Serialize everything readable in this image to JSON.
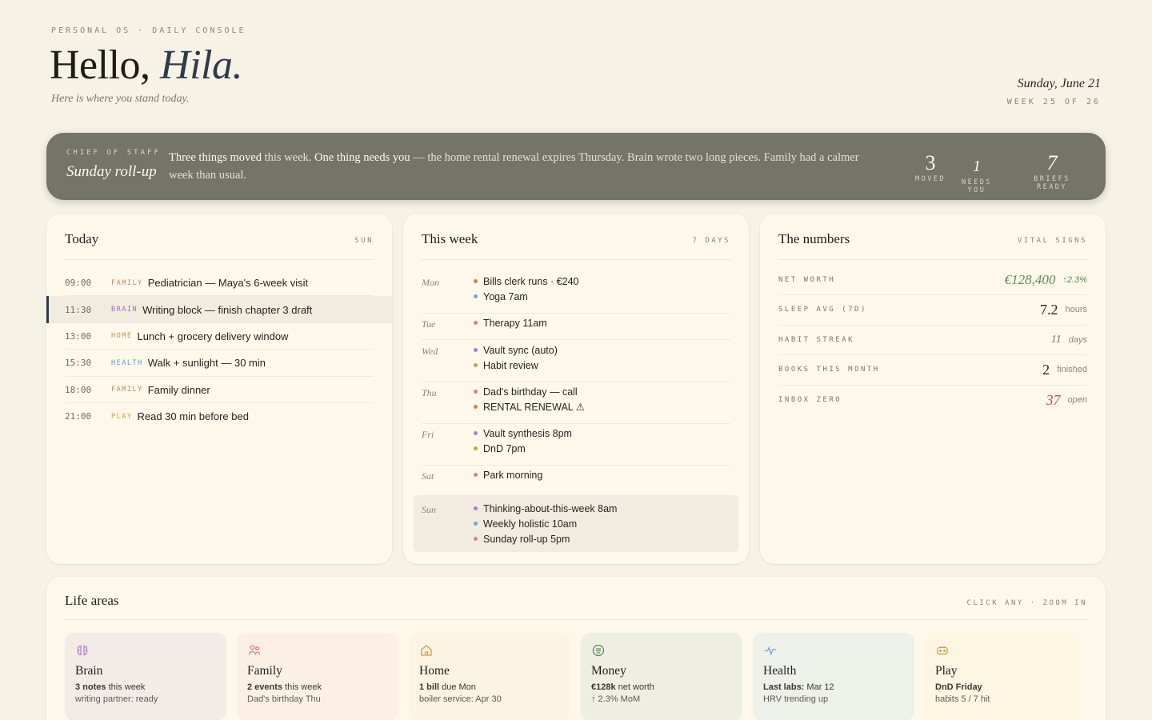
{
  "header": {
    "eyebrow": "PERSONAL OS · DAILY CONSOLE",
    "greeting": "Hello,",
    "name": "Hila.",
    "subtitle": "Here is where you stand today.",
    "date": "Sunday, June 21",
    "week": "WEEK 25 OF 26"
  },
  "banner": {
    "label": "CHIEF OF STAFF",
    "title": "Sunday roll-up",
    "bold1": "Three things moved",
    "text1": " this week. ",
    "bold2": "One thing needs you",
    "text2": " — the home rental renewal expires Thursday. Brain wrote two long pieces. Family had a calmer week than usual.",
    "stats": [
      {
        "num": "3",
        "label": "MOVED"
      },
      {
        "num": "1",
        "label": "NEEDS YOU"
      },
      {
        "num": "7",
        "label": "BRIEFS READY"
      }
    ]
  },
  "today": {
    "title": "Today",
    "tag": "SUN",
    "rows": [
      {
        "time": "09:00",
        "cat": "FAMILY",
        "color": "#c2896a",
        "text": "Pediatrician — Maya's 6-week visit"
      },
      {
        "time": "11:30",
        "cat": "BRAIN",
        "color": "#a56ac9",
        "text": "Writing block — finish chapter 3 draft",
        "active": true
      },
      {
        "time": "13:00",
        "cat": "HOME",
        "color": "#c9924a",
        "text": "Lunch + grocery delivery window"
      },
      {
        "time": "15:30",
        "cat": "HEALTH",
        "color": "#6a98c4",
        "text": "Walk + sunlight — 30 min"
      },
      {
        "time": "18:00",
        "cat": "FAMILY",
        "color": "#c2896a",
        "text": "Family dinner"
      },
      {
        "time": "21:00",
        "cat": "PLAY",
        "color": "#c8a24c",
        "text": "Read 30 min before bed"
      }
    ]
  },
  "week": {
    "title": "This week",
    "tag": "7 DAYS",
    "days": [
      {
        "day": "Mon",
        "items": [
          {
            "t": "Bills clerk runs · €240",
            "c": "#c2894f"
          },
          {
            "t": "Yoga 7am",
            "c": "#7aa4cf"
          }
        ]
      },
      {
        "day": "Tue",
        "items": [
          {
            "t": "Therapy 11am",
            "c": "#d97f86"
          }
        ]
      },
      {
        "day": "Wed",
        "items": [
          {
            "t": "Vault sync (auto)",
            "c": "#b07ad6"
          },
          {
            "t": "Habit review",
            "c": "#c9a14f"
          }
        ]
      },
      {
        "day": "Thu",
        "items": [
          {
            "t": "Dad's birthday — call",
            "c": "#d97f86"
          },
          {
            "t": "RENTAL RENEWAL ⚠",
            "c": "#c2894f"
          }
        ]
      },
      {
        "day": "Fri",
        "items": [
          {
            "t": "Vault synthesis 8pm",
            "c": "#b07ad6"
          },
          {
            "t": "DnD 7pm",
            "c": "#c9a14f"
          }
        ]
      },
      {
        "day": "Sat",
        "items": [
          {
            "t": "Park morning",
            "c": "#d97f86"
          }
        ]
      },
      {
        "day": "Sun",
        "items": [
          {
            "t": "Thinking-about-this-week 8am",
            "c": "#b07ad6"
          },
          {
            "t": "Weekly holistic 10am",
            "c": "#7aa4cf"
          },
          {
            "t": "Sunday roll-up 5pm",
            "c": "#d97f86"
          }
        ]
      }
    ]
  },
  "numbers": {
    "title": "The numbers",
    "tag": "VITAL SIGNS",
    "rows": [
      {
        "label": "NET WORTH",
        "value": "€128,400",
        "unit": "↑2.3%",
        "vcolor": "#5f8a5a",
        "ucolor": "#5f8a5a",
        "italic": true
      },
      {
        "label": "SLEEP AVG (7D)",
        "value": "7.2",
        "unit": "hours",
        "vcolor": "#26241f",
        "ucolor": "#8a857a",
        "italic": false
      },
      {
        "label": "HABIT STREAK",
        "value": "11",
        "unit": "days",
        "vcolor": "#5f8a5a",
        "ucolor": "#8a857a",
        "italic": true
      },
      {
        "label": "BOOKS THIS MONTH",
        "value": "2",
        "unit": "finished",
        "vcolor": "#26241f",
        "ucolor": "#8a857a",
        "italic": false
      },
      {
        "label": "INBOX ZERO",
        "value": "37",
        "unit": "open",
        "vcolor": "#c0506a",
        "ucolor": "#8a857a",
        "italic": true
      }
    ]
  },
  "areas": {
    "title": "Life areas",
    "tag": "CLICK ANY · ZOOM IN",
    "items": [
      {
        "icon": "brain-icon",
        "name": "Brain",
        "b1": "3 notes",
        "t1": " this week",
        "l2": "writing partner: ready",
        "bg": "#f3ece6",
        "c": "#b07ad6"
      },
      {
        "icon": "family-icon",
        "name": "Family",
        "b1": "2 events",
        "t1": " this week",
        "l2": "Dad's birthday Thu",
        "bg": "#fcf0e5",
        "c": "#d97f86"
      },
      {
        "icon": "home-icon",
        "name": "Home",
        "b1": "1 bill",
        "t1": " due Mon",
        "l2": "boiler service: Apr 30",
        "bg": "#fcf3e2",
        "c": "#c9a14f"
      },
      {
        "icon": "money-icon",
        "name": "Money",
        "b1": "€128k",
        "t1": " net worth",
        "l2": "↑ 2.3% MoM",
        "bg": "#eeefe2",
        "c": "#5f8a5a"
      },
      {
        "icon": "health-icon",
        "name": "Health",
        "b1": "Last labs:",
        "t1": " Mar 12",
        "l2": "HRV trending up",
        "bg": "#eef0ea",
        "c": "#7aa4cf"
      },
      {
        "icon": "play-icon",
        "name": "Play",
        "b1": "DnD Friday",
        "t1": "",
        "l2": "habits 5 / 7 hit",
        "bg": "#fdf6e3",
        "c": "#c9a14f"
      }
    ]
  }
}
